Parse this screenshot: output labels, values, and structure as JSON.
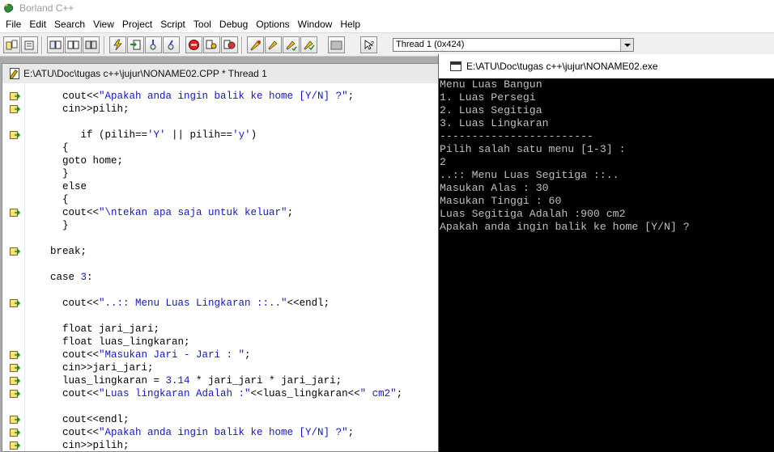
{
  "app": {
    "title": "Borland C++"
  },
  "menu": [
    "File",
    "Edit",
    "Search",
    "View",
    "Project",
    "Script",
    "Tool",
    "Debug",
    "Options",
    "Window",
    "Help"
  ],
  "toolbar": {
    "thread_selector": "Thread 1 (0x424)"
  },
  "editor": {
    "title": "E:\\ATU\\Doc\\tugas c++\\jujur\\NONAME02.CPP * Thread 1",
    "lines": [
      {
        "bp": true,
        "parts": [
          {
            "t": "      cout<<"
          },
          {
            "t": "\"Apakah anda ingin balik ke home [Y/N] ?\"",
            "s": true
          },
          {
            "t": ";"
          }
        ]
      },
      {
        "bp": true,
        "parts": [
          {
            "t": "      cin>>pilih;"
          }
        ]
      },
      {
        "bp": false,
        "parts": [
          {
            "t": ""
          }
        ]
      },
      {
        "bp": true,
        "parts": [
          {
            "t": "         if (pilih=="
          },
          {
            "t": "'Y'",
            "s": true
          },
          {
            "t": " || pilih=="
          },
          {
            "t": "'y'",
            "s": true
          },
          {
            "t": ")"
          }
        ]
      },
      {
        "bp": false,
        "parts": [
          {
            "t": "      {"
          }
        ]
      },
      {
        "bp": false,
        "parts": [
          {
            "t": "      goto home;"
          }
        ]
      },
      {
        "bp": false,
        "parts": [
          {
            "t": "      }"
          }
        ]
      },
      {
        "bp": false,
        "parts": [
          {
            "t": "      else"
          }
        ]
      },
      {
        "bp": false,
        "parts": [
          {
            "t": "      {"
          }
        ]
      },
      {
        "bp": true,
        "parts": [
          {
            "t": "      cout<<"
          },
          {
            "t": "\"\\ntekan apa saja untuk keluar\"",
            "s": true
          },
          {
            "t": ";"
          }
        ]
      },
      {
        "bp": false,
        "parts": [
          {
            "t": "      }"
          }
        ]
      },
      {
        "bp": false,
        "parts": [
          {
            "t": ""
          }
        ]
      },
      {
        "bp": true,
        "parts": [
          {
            "t": "    break;"
          }
        ]
      },
      {
        "bp": false,
        "parts": [
          {
            "t": ""
          }
        ]
      },
      {
        "bp": false,
        "parts": [
          {
            "t": "    case "
          },
          {
            "t": "3",
            "s": true
          },
          {
            "t": ":"
          }
        ]
      },
      {
        "bp": false,
        "parts": [
          {
            "t": ""
          }
        ]
      },
      {
        "bp": true,
        "parts": [
          {
            "t": "      cout<<"
          },
          {
            "t": "\"..:: Menu Luas Lingkaran ::..\"",
            "s": true
          },
          {
            "t": "<<endl;"
          }
        ]
      },
      {
        "bp": false,
        "parts": [
          {
            "t": ""
          }
        ]
      },
      {
        "bp": false,
        "parts": [
          {
            "t": "      float jari_jari;"
          }
        ]
      },
      {
        "bp": false,
        "parts": [
          {
            "t": "      float luas_lingkaran;"
          }
        ]
      },
      {
        "bp": true,
        "parts": [
          {
            "t": "      cout<<"
          },
          {
            "t": "\"Masukan Jari - Jari : \"",
            "s": true
          },
          {
            "t": ";"
          }
        ]
      },
      {
        "bp": true,
        "parts": [
          {
            "t": "      cin>>jari_jari;"
          }
        ]
      },
      {
        "bp": true,
        "parts": [
          {
            "t": "      luas_lingkaran = "
          },
          {
            "t": "3.14",
            "s": true
          },
          {
            "t": " * jari_jari * jari_jari;"
          }
        ]
      },
      {
        "bp": true,
        "parts": [
          {
            "t": "      cout<<"
          },
          {
            "t": "\"Luas lingkaran Adalah :\"",
            "s": true
          },
          {
            "t": "<<luas_lingkaran<<"
          },
          {
            "t": "\" cm2\"",
            "s": true
          },
          {
            "t": ";"
          }
        ]
      },
      {
        "bp": false,
        "parts": [
          {
            "t": ""
          }
        ]
      },
      {
        "bp": true,
        "parts": [
          {
            "t": "      cout<<endl;"
          }
        ]
      },
      {
        "bp": true,
        "parts": [
          {
            "t": "      cout<<"
          },
          {
            "t": "\"Apakah anda ingin balik ke home [Y/N] ?\"",
            "s": true
          },
          {
            "t": ";"
          }
        ]
      },
      {
        "bp": true,
        "parts": [
          {
            "t": "      cin>>pilih;"
          }
        ]
      }
    ]
  },
  "console": {
    "title": "E:\\ATU\\Doc\\tugas c++\\jujur\\NONAME02.exe",
    "lines": [
      "Menu Luas Bangun",
      "1. Luas Persegi",
      "2. Luas Segitiga",
      "3. Luas Lingkaran",
      "------------------------",
      "Pilih salah satu menu [1-3] :",
      "2",
      "..:: Menu Luas Segitiga ::..",
      "Masukan Alas : 30",
      "Masukan Tinggi : 60",
      "Luas Segitiga Adalah :900 cm2",
      "Apakah anda ingin balik ke home [Y/N] ?"
    ]
  }
}
